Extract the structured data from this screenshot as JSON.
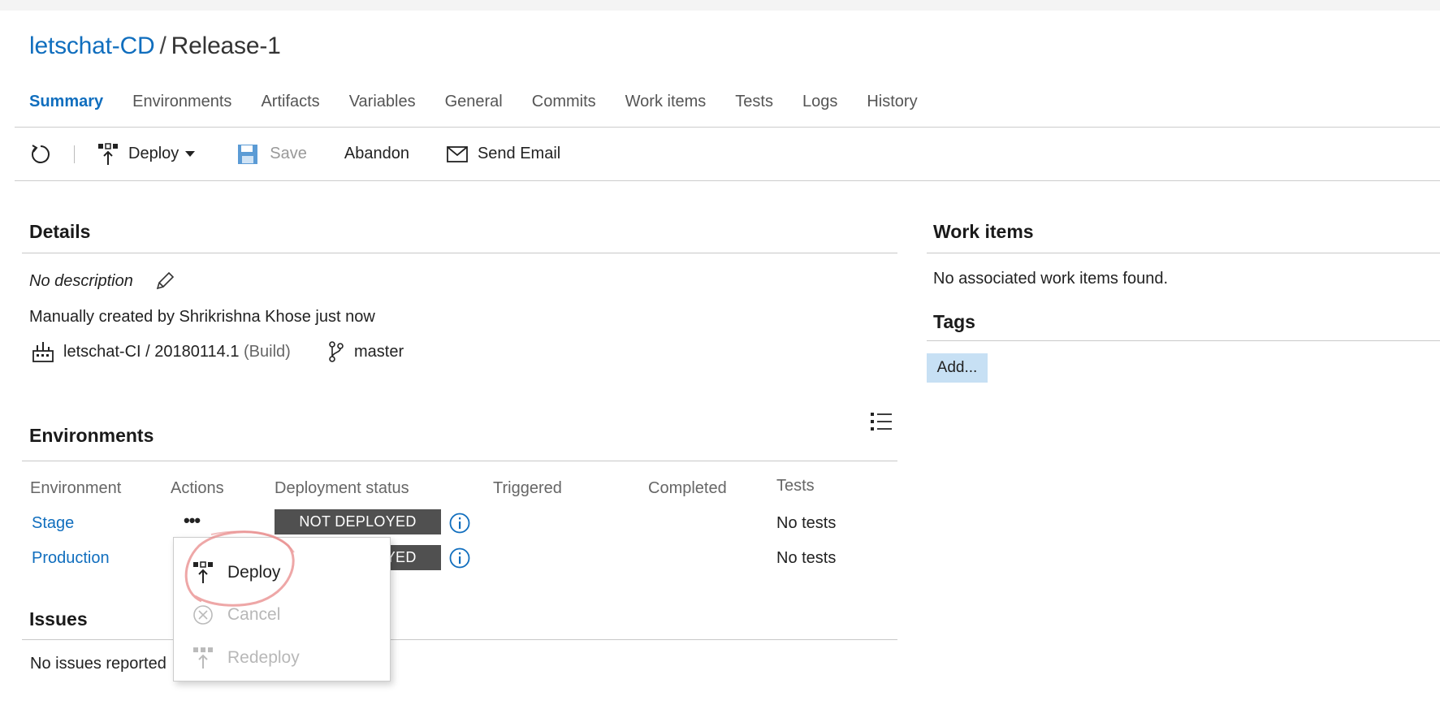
{
  "breadcrumb": {
    "definition": "letschat-CD",
    "separator": "/",
    "release": "Release-1"
  },
  "tabs": [
    {
      "label": "Summary",
      "active": true
    },
    {
      "label": "Environments"
    },
    {
      "label": "Artifacts"
    },
    {
      "label": "Variables"
    },
    {
      "label": "General"
    },
    {
      "label": "Commits"
    },
    {
      "label": "Work items"
    },
    {
      "label": "Tests"
    },
    {
      "label": "Logs"
    },
    {
      "label": "History"
    }
  ],
  "toolbar": {
    "refresh_icon": "refresh-icon",
    "deploy_label": "Deploy",
    "save_label": "Save",
    "abandon_label": "Abandon",
    "email_label": "Send Email"
  },
  "details": {
    "title": "Details",
    "description": "No description",
    "created": "Manually created by Shrikrishna Khose just now",
    "artifact_name": "letschat-CI / 20180114.1",
    "artifact_type": "(Build)",
    "branch": "master"
  },
  "work_items": {
    "title": "Work items",
    "empty_text": "No associated work items found."
  },
  "tags": {
    "title": "Tags",
    "add_label": "Add..."
  },
  "environments": {
    "title": "Environments",
    "columns": [
      "Environment",
      "Actions",
      "Deployment status",
      "Triggered",
      "Completed",
      "Tests"
    ],
    "rows": [
      {
        "name": "Stage",
        "status": "NOT DEPLOYED",
        "tests": "No tests"
      },
      {
        "name": "Production",
        "status": "NOT DEPLOYED",
        "tests": "No tests"
      }
    ],
    "actions_label": "•••"
  },
  "issues": {
    "title": "Issues",
    "empty_text": "No issues reported"
  },
  "context_menu": {
    "items": [
      {
        "label": "Deploy",
        "enabled": true
      },
      {
        "label": "Cancel",
        "enabled": false
      },
      {
        "label": "Redeploy",
        "enabled": false
      }
    ]
  },
  "colors": {
    "accent": "#106ebe",
    "badge": "#505050",
    "annotation": "#e88a8a"
  }
}
